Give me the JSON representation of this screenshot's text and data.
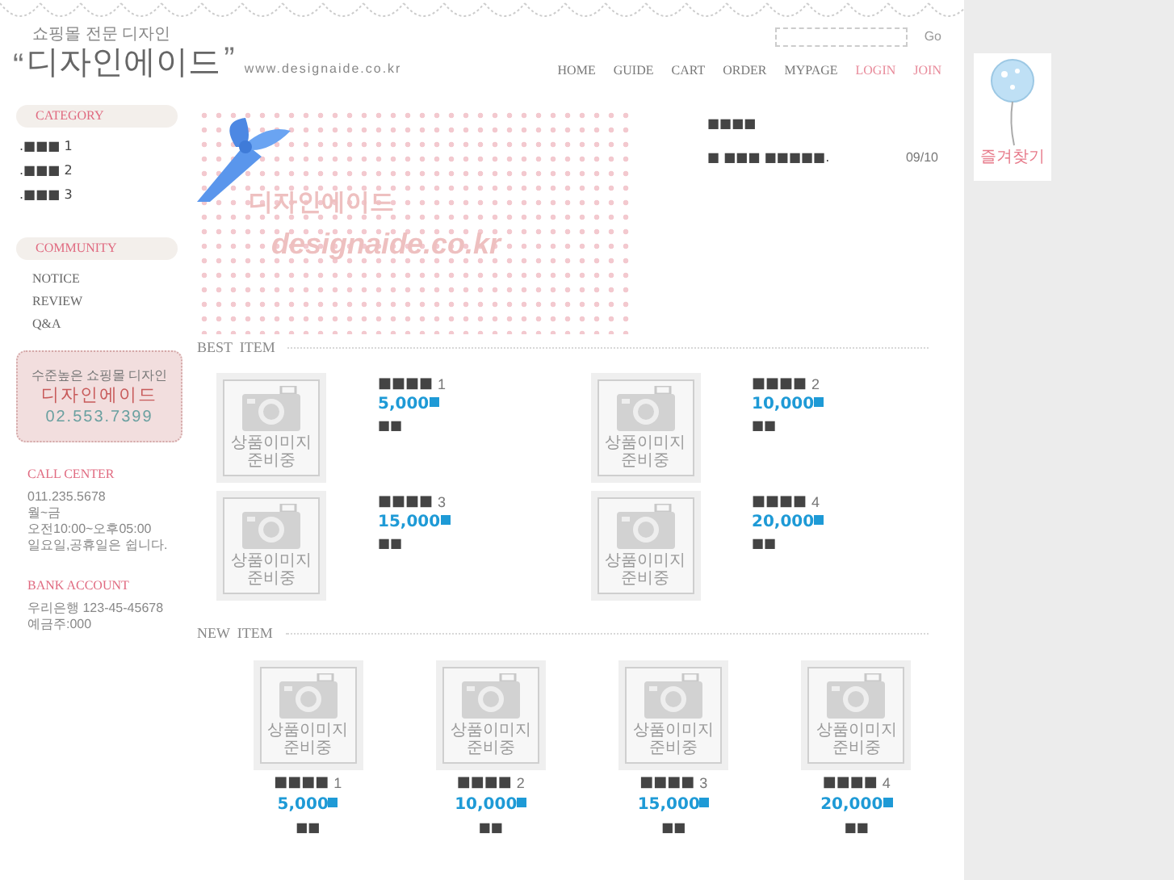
{
  "header": {
    "tagline": "쇼핑몰 전문 디자인",
    "quote_open": "“",
    "logo": "디자인에이드",
    "quote_close": "”",
    "url": "www.designaide.co.kr",
    "search_button": "Go",
    "nav": [
      {
        "label": "HOME",
        "kind": "normal"
      },
      {
        "label": "GUIDE",
        "kind": "normal"
      },
      {
        "label": "CART",
        "kind": "normal"
      },
      {
        "label": "ORDER",
        "kind": "normal"
      },
      {
        "label": "MYPAGE",
        "kind": "normal"
      },
      {
        "label": "LOGIN",
        "kind": "accent"
      },
      {
        "label": "JOIN",
        "kind": "accent"
      }
    ]
  },
  "sidebar": {
    "category_title": "CATEGORY",
    "categories": [
      {
        "bullet": ".",
        "label": "■■■",
        "number": "1"
      },
      {
        "bullet": ".",
        "label": "■■■",
        "number": "2"
      },
      {
        "bullet": ".",
        "label": "■■■",
        "number": "3"
      }
    ],
    "community_title": "COMMUNITY",
    "community": [
      "NOTICE",
      "REVIEW",
      "Q&A"
    ],
    "promo": {
      "line_1": "수준높은 쇼핑몰 디자인",
      "line_2": "디자인에이드",
      "phone": "02.553.7399"
    },
    "call_center": {
      "title": "CALL CENTER",
      "lines": [
        "011.235.5678",
        "월~금",
        "오전10:00~오후05:00",
        "일요일,공휴일은 쉽니다."
      ]
    },
    "bank_account": {
      "title": "BANK ACCOUNT",
      "lines": [
        "우리은행 123-45-45678",
        "예금주:000"
      ]
    }
  },
  "banner": {
    "title": "디자인에이드",
    "subtitle": "designaide.co.kr"
  },
  "notice": {
    "title": "■■■■",
    "items": [
      {
        "text": "■ ■■■ ■■■■■.",
        "date": "09/10"
      }
    ]
  },
  "best_items": {
    "title": "BEST  ITEM",
    "items": [
      {
        "image_text": "상품이미지 준비중",
        "name": "■■■■",
        "number": "1",
        "price": "5,000",
        "tag": "■■"
      },
      {
        "image_text": "상품이미지 준비중",
        "name": "■■■■",
        "number": "2",
        "price": "10,000",
        "tag": "■■"
      },
      {
        "image_text": "상품이미지 준비중",
        "name": "■■■■",
        "number": "3",
        "price": "15,000",
        "tag": "■■"
      },
      {
        "image_text": "상품이미지 준비중",
        "name": "■■■■",
        "number": "4",
        "price": "20,000",
        "tag": "■■"
      }
    ]
  },
  "new_items": {
    "title": "NEW  ITEM",
    "items": [
      {
        "image_text": "상품이미지 준비중",
        "name": "■■■■",
        "number": "1",
        "price": "5,000",
        "tag": "■■"
      },
      {
        "image_text": "상품이미지 준비중",
        "name": "■■■■",
        "number": "2",
        "price": "10,000",
        "tag": "■■"
      },
      {
        "image_text": "상품이미지 준비중",
        "name": "■■■■",
        "number": "3",
        "price": "15,000",
        "tag": "■■"
      },
      {
        "image_text": "상품이미지 준비중",
        "name": "■■■■",
        "number": "4",
        "price": "20,000",
        "tag": "■■"
      }
    ]
  },
  "bookmark": {
    "label": "즐겨찾기"
  }
}
